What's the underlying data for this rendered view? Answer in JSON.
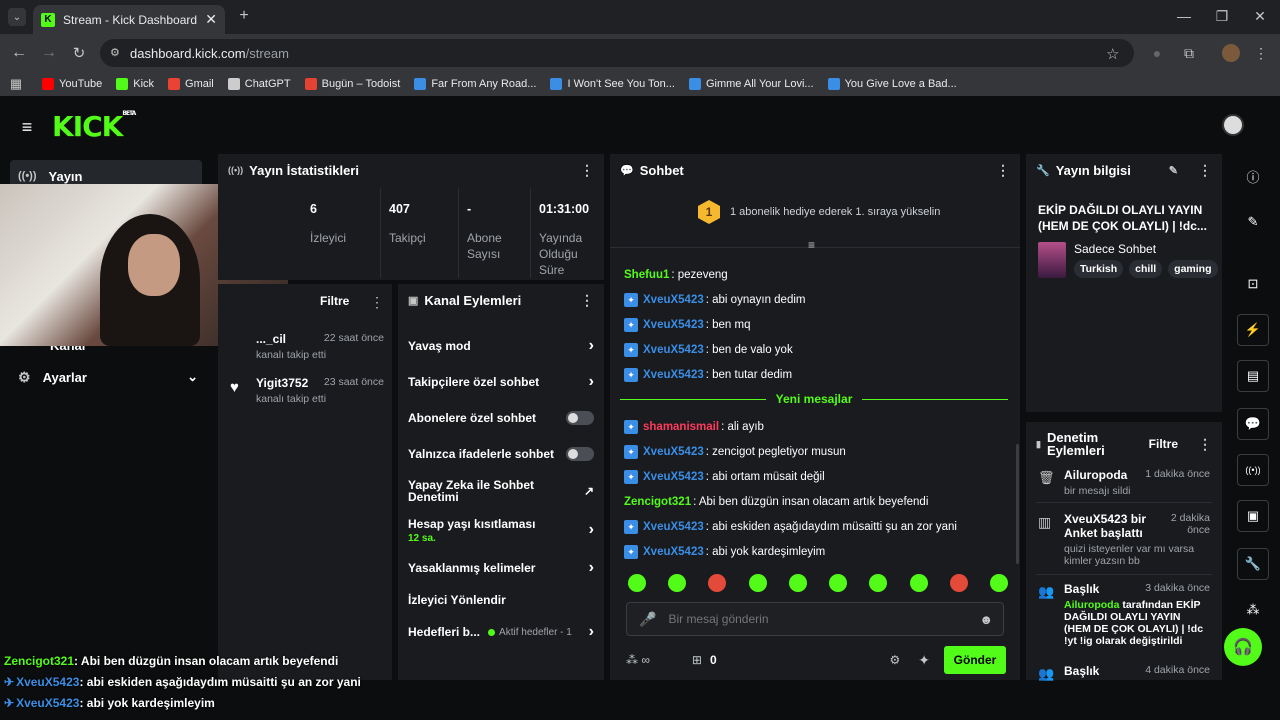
{
  "browser": {
    "tab_title": "Stream - Kick Dashboard",
    "url_host": "dashboard.kick.com",
    "url_path": "/stream",
    "bookmarks": [
      {
        "label": "YouTube",
        "color": "#ff0000"
      },
      {
        "label": "Kick",
        "color": "#53fc18"
      },
      {
        "label": "Gmail",
        "color": "#ea4335"
      },
      {
        "label": "ChatGPT",
        "color": "#cccccc"
      },
      {
        "label": "Bugün – Todoist",
        "color": "#e44332"
      },
      {
        "label": "Far From Any Road...",
        "color": "#3a8ee6"
      },
      {
        "label": "I Won't See You Ton...",
        "color": "#3a8ee6"
      },
      {
        "label": "Gimme All Your Lovi...",
        "color": "#3a8ee6"
      },
      {
        "label": "You Give Love a Bad...",
        "color": "#3a8ee6"
      }
    ]
  },
  "header": {
    "logo": "KICK",
    "logo_sup": "BETA"
  },
  "sidebar": {
    "item1": "Yayın",
    "item2": "Kanal",
    "item3": "Ayarlar"
  },
  "stats": {
    "title": "Yayın İstatistikleri",
    "items": [
      {
        "value": "6",
        "label": "İzleyici"
      },
      {
        "value": "407",
        "label": "Takipçi"
      },
      {
        "value": "-",
        "label": "Abone Sayısı"
      },
      {
        "value": "01:31:00",
        "label": "Yayında Olduğu Süre"
      }
    ]
  },
  "activity": {
    "filter": "Filtre",
    "items": [
      {
        "user": "..._cil",
        "time": "22 saat önce",
        "desc": "kanalı takip etti"
      },
      {
        "user": "Yigit3752",
        "time": "23 saat önce",
        "desc": "kanalı takip etti"
      }
    ]
  },
  "actions": {
    "title": "Kanal Eylemleri",
    "slow": "Yavaş mod",
    "followers": "Takipçilere özel sohbet",
    "subs": "Abonelere özel sohbet",
    "emotes": "Yalnızca ifadelerle sohbet",
    "ai": "Yapay Zeka ile Sohbet Denetimi",
    "age": "Hesap yaşı kısıtlaması",
    "age_val": "12 sa.",
    "banned": "Yasaklanmış kelimeler",
    "redirect": "İzleyici Yönlendir",
    "goals": "Hedefleri b...",
    "goals_status": "Aktif hedefler - 1"
  },
  "chat": {
    "title": "Sohbet",
    "gift_rank": "1",
    "gift_text": "1 abonelik hediye ederek 1. sıraya yükselin",
    "divider": "Yeni mesajlar",
    "before": [
      {
        "user": "Shefuu1",
        "msg": ": pezeveng",
        "color": "#53fc18",
        "badge": false
      },
      {
        "user": "XveuX5423",
        "msg": ": abi oynayın dedim",
        "color": "#3a8ee6",
        "badge": true
      },
      {
        "user": "XveuX5423",
        "msg": ": ben mq",
        "color": "#3a8ee6",
        "badge": true
      },
      {
        "user": "XveuX5423",
        "msg": ": ben de valo yok",
        "color": "#3a8ee6",
        "badge": true
      },
      {
        "user": "XveuX5423",
        "msg": ": ben tutar dedim",
        "color": "#3a8ee6",
        "badge": true
      }
    ],
    "after": [
      {
        "user": "shamanismail",
        "msg": ": ali ayıb",
        "color": "#ff3b5c",
        "badge": true
      },
      {
        "user": "XveuX5423",
        "msg": ": zencigot pegletiyor musun",
        "color": "#3a8ee6",
        "badge": true
      },
      {
        "user": "XveuX5423",
        "msg": ": abi ortam müsait değil",
        "color": "#3a8ee6",
        "badge": true
      },
      {
        "user": "Zencigot321",
        "msg": ": Abi ben düzgün insan olacam artık beyefendi",
        "color": "#53fc18",
        "badge": false
      },
      {
        "user": "XveuX5423",
        "msg": ": abi eskiden aşağıdaydım müsaitti şu an zor yani",
        "color": "#3a8ee6",
        "badge": true
      },
      {
        "user": "XveuX5423",
        "msg": ": abi yok kardeşimleyim",
        "color": "#3a8ee6",
        "badge": true
      }
    ],
    "placeholder": "Bir mesaj gönderin",
    "points": "0",
    "send": "Gönder"
  },
  "info": {
    "title": "Yayın bilgisi",
    "stream_title": "EKİP DAĞILDI OLAYLI YAYIN (HEM DE ÇOK OLAYLI) | !dc...",
    "category": "Sadece Sohbet",
    "tags": [
      "Turkish",
      "chill",
      "gaming"
    ]
  },
  "mod": {
    "title": "Denetim Eylemleri",
    "filter": "Filtre",
    "items": [
      {
        "user": "Ailuropoda",
        "time": "1 dakika önce",
        "desc": "bir mesajı sildi"
      },
      {
        "user": "XveuX5423 bir Anket başlattı",
        "time": "2 dakika önce",
        "desc": "quizi isteyenler var mı varsa kimler yazsın bb"
      },
      {
        "user": "Başlık",
        "time": "3 dakika önce",
        "desc_user": "Ailuropoda",
        "desc": " tarafından EKİP DAĞILDI OLAYLI YAYIN (HEM DE ÇOK OLAYLI) | !dc !yt !ig olarak değiştirildi"
      },
      {
        "user": "Başlık",
        "time": "4 dakika önce",
        "desc": ""
      }
    ]
  },
  "overlay": [
    {
      "user": "Zencigot321",
      "msg": ": Abi ben düzgün insan olacam artık beyefendi"
    },
    {
      "user": "XveuX5423",
      "msg": ": abi eskiden aşağıdaydım müsaitti şu an zor yani"
    },
    {
      "user": "XveuX5423",
      "msg": ": abi yok kardeşimleyim"
    }
  ]
}
